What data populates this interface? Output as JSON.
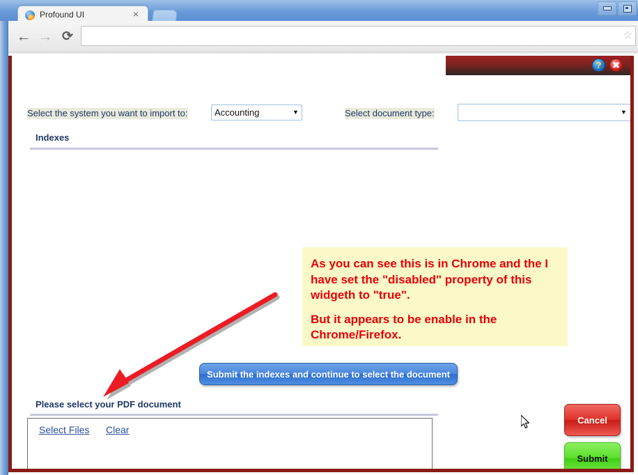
{
  "browser": {
    "tab": {
      "title": "Profound UI",
      "favicon_name": "profound-ui-logo-icon",
      "close_label": "×"
    },
    "new_tab_label": "",
    "toolbar": {
      "back_label": "←",
      "forward_label": "→",
      "reload_label": "⟳",
      "address_value": "",
      "address_placeholder": "",
      "bookmark_label": "☆"
    },
    "window_controls": {
      "minimize_label": "",
      "maximize_label": ""
    }
  },
  "dialog": {
    "help_label": "?",
    "close_label": "✖",
    "fields": {
      "system_label": "Select the system you want to import to:",
      "system_value": "Accounting",
      "system_options": [
        "Accounting"
      ],
      "system_arrow": "▼",
      "doctype_label": "Select document type:",
      "doctype_value": "",
      "doctype_options": [
        ""
      ],
      "doctype_arrow": "▼"
    },
    "sections": {
      "indexes_title": "Indexes",
      "pdf_title": "Please select your PDF document"
    },
    "submit_indexes_label": "Submit the indexes and continue to select the document",
    "file_box": {
      "select_files_label": "Select Files",
      "clear_label": "Clear"
    },
    "actions": {
      "cancel_label": "Cancel",
      "submit_label": "Submit"
    }
  },
  "annotation": {
    "paragraph_1": "As you can see this is in Chrome and the I have set the \"disabled\" property of this widgeth to \"true\".",
    "paragraph_2": "But it appears to be enable in the Chrome/Firefox.",
    "arrow_color": "#ec1c24",
    "note_background": "#fbf9c8",
    "text_color": "#e8000a"
  },
  "colors": {
    "dialog_border": "#8b1a16",
    "titlebar_red": "#9c2220",
    "label_highlight": "#e9e9dc",
    "label_text": "#1f3864",
    "submit_blue": "#4b87dd",
    "cancel_red": "#e0332b",
    "submit_green": "#5ce02c"
  }
}
